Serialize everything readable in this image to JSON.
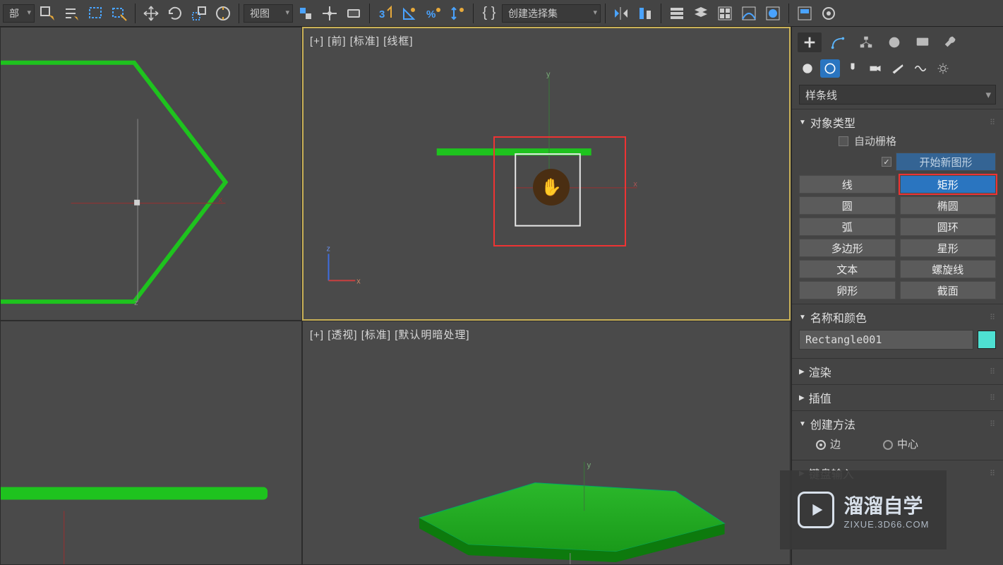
{
  "toolbar": {
    "filter_dropdown": "部",
    "render_dropdown": "视图",
    "selset_placeholder": "创建选择集"
  },
  "viewports": {
    "top_left_label": "",
    "top_right_label": "[+] [前] [标准] [线框]",
    "bottom_right_label": "[+] [透视] [标准] [默认明暗处理]"
  },
  "panel": {
    "subcategory": "样条线",
    "rollouts": {
      "object_type": "对象类型",
      "auto_grid": "自动栅格",
      "start_new_shape": "开始新图形",
      "name_color": "名称和颜色",
      "render": "渲染",
      "interp": "插值",
      "creation_method": "创建方法",
      "keyboard_entry": "键盘输入"
    },
    "shapes": {
      "line": "线",
      "rectangle": "矩形",
      "circle": "圆",
      "ellipse": "椭圆",
      "arc": "弧",
      "donut": "圆环",
      "ngon": "多边形",
      "star": "星形",
      "text": "文本",
      "helix": "螺旋线",
      "egg": "卵形",
      "section": "截面"
    },
    "object_name": "Rectangle001",
    "creation": {
      "edge": "边",
      "center": "中心"
    }
  },
  "watermark": {
    "brand": "溜溜自学",
    "url": "ZIXUE.3D66.COM"
  }
}
